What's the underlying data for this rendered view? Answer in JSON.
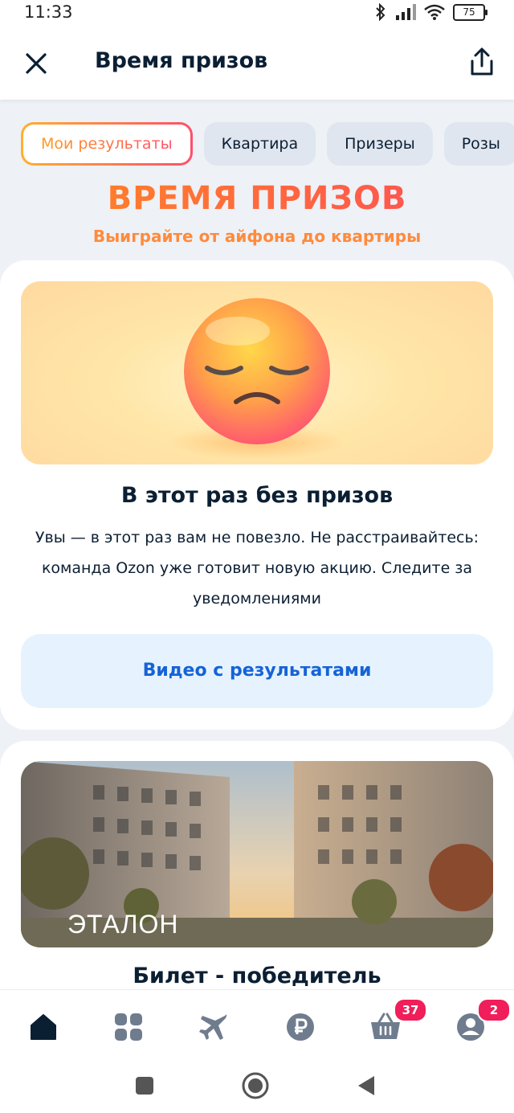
{
  "status_bar": {
    "time": "11:33",
    "battery": "75"
  },
  "header": {
    "title": "Время призов"
  },
  "tabs": [
    {
      "label": "Мои результаты",
      "active": true
    },
    {
      "label": "Квартира",
      "active": false
    },
    {
      "label": "Призеры",
      "active": false
    },
    {
      "label": "Розы",
      "active": false
    }
  ],
  "promo": {
    "title": "ВРЕМЯ ПРИЗОВ",
    "subtitle": "Выиграйте от айфона до квартиры"
  },
  "result_card": {
    "title": "В этот раз без призов",
    "text": "Увы — в этот раз вам не повезло. Не расстраивайтесь: команда Ozon уже готовит новую акцию. Следите за уведомлениями",
    "button": "Видео с результатами"
  },
  "prize_card": {
    "brand": "ЭТАЛОН",
    "title": "Билет - победитель"
  },
  "bottom_nav": {
    "items": [
      {
        "icon": "home-icon"
      },
      {
        "icon": "catalog-icon"
      },
      {
        "icon": "travel-icon"
      },
      {
        "icon": "ruble-icon"
      },
      {
        "icon": "cart-icon",
        "badge": "37"
      },
      {
        "icon": "profile-icon",
        "badge": "2"
      }
    ]
  },
  "colors": {
    "accent_gradient_start": "#ff8a1f",
    "accent_gradient_end": "#ff4a5a",
    "link_blue": "#1563d6",
    "badge": "#f01e5a"
  }
}
